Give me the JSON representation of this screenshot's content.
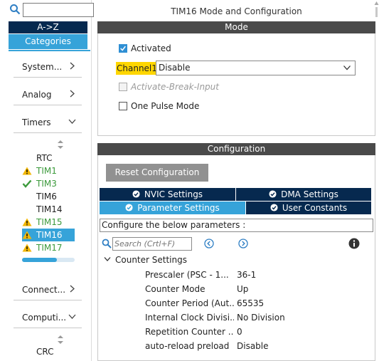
{
  "sidebar": {
    "search_value": "",
    "sort_az": "A->Z",
    "categories_label": "Categories",
    "categories": [
      {
        "label": "System...",
        "state": "collapsed"
      },
      {
        "label": "Analog",
        "state": "collapsed"
      },
      {
        "label": "Timers",
        "state": "expanded"
      }
    ],
    "timers": [
      {
        "name": "RTC",
        "status": "none"
      },
      {
        "name": "TIM1",
        "status": "warning"
      },
      {
        "name": "TIM3",
        "status": "ok"
      },
      {
        "name": "TIM6",
        "status": "none"
      },
      {
        "name": "TIM14",
        "status": "none"
      },
      {
        "name": "TIM15",
        "status": "warning"
      },
      {
        "name": "TIM16",
        "status": "warning",
        "selected": true
      },
      {
        "name": "TIM17",
        "status": "warning"
      }
    ],
    "scroll_fraction": 0.66,
    "lower_categories": [
      {
        "label": "Connect...",
        "state": "collapsed"
      },
      {
        "label": "Computi...",
        "state": "expanded"
      }
    ],
    "computing_items": [
      "CRC"
    ]
  },
  "main": {
    "title": "TIM16 Mode and Configuration",
    "mode_header": "Mode",
    "activated_label": "Activated",
    "activated_checked": true,
    "channel_label": "Channel1",
    "channel_value": "Disable",
    "break_input_label": "Activate-Break-Input",
    "one_pulse_label": "One Pulse Mode",
    "config_header": "Configuration",
    "reset_label": "Reset Configuration",
    "tabs": {
      "nvic": "NVIC Settings",
      "dma": "DMA Settings",
      "parameter": "Parameter Settings",
      "user_constants": "User Constants"
    },
    "configure_hint": "Configure the below parameters :",
    "search_placeholder": "Search (Crtl+F)",
    "group_label": "Counter Settings",
    "params": [
      {
        "name": "Prescaler (PSC - 1...",
        "value": "36-1"
      },
      {
        "name": "Counter Mode",
        "value": "Up"
      },
      {
        "name": "Counter Period (Aut...",
        "value": "65535"
      },
      {
        "name": "Internal Clock Divisi...",
        "value": "No Division"
      },
      {
        "name": "Repetition Counter ...",
        "value": "0"
      },
      {
        "name": "auto-reload preload",
        "value": "Disable"
      }
    ]
  },
  "colors": {
    "accent": "#36a3d9",
    "dark_tab": "#06294f",
    "header_bar": "#4a4a4a",
    "warning": "#f2b705",
    "ok": "#3c9a3c",
    "highlight": "#ffd600"
  },
  "icons": {
    "search": "search-icon",
    "chevron_right": "chevron-right-icon",
    "chevron_down": "chevron-down-icon",
    "warning": "warning-icon",
    "check": "check-icon",
    "prev": "prev-icon",
    "next": "next-icon",
    "info": "info-icon",
    "sort": "sort-icon"
  }
}
